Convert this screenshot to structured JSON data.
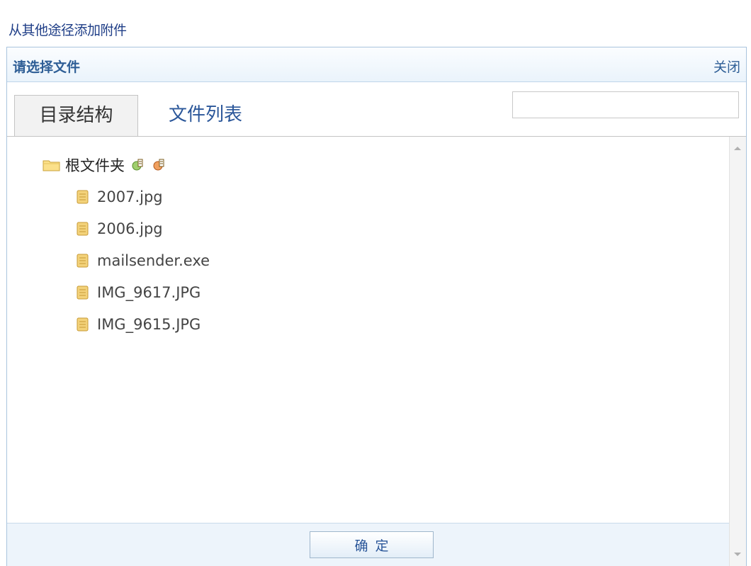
{
  "top_link": "从其他途径添加附件",
  "dialog": {
    "title": "请选择文件",
    "close_label": "关闭"
  },
  "tabs": [
    {
      "label": "目录结构",
      "active": true
    },
    {
      "label": "文件列表",
      "active": false
    }
  ],
  "search": {
    "value": ""
  },
  "tree": {
    "root": {
      "label": "根文件夹",
      "icon": "folder-icon"
    },
    "files": [
      {
        "name": "2007.jpg",
        "icon": "file-icon"
      },
      {
        "name": "2006.jpg",
        "icon": "file-icon"
      },
      {
        "name": "mailsender.exe",
        "icon": "file-icon"
      },
      {
        "name": "IMG_9617.JPG",
        "icon": "file-icon"
      },
      {
        "name": "IMG_9615.JPG",
        "icon": "file-icon"
      }
    ]
  },
  "footer": {
    "ok_label": "确定"
  },
  "colors": {
    "link": "#1f3e87",
    "title": "#2e5e96",
    "border": "#a9c4de",
    "footer_bg": "#edf4fb"
  }
}
